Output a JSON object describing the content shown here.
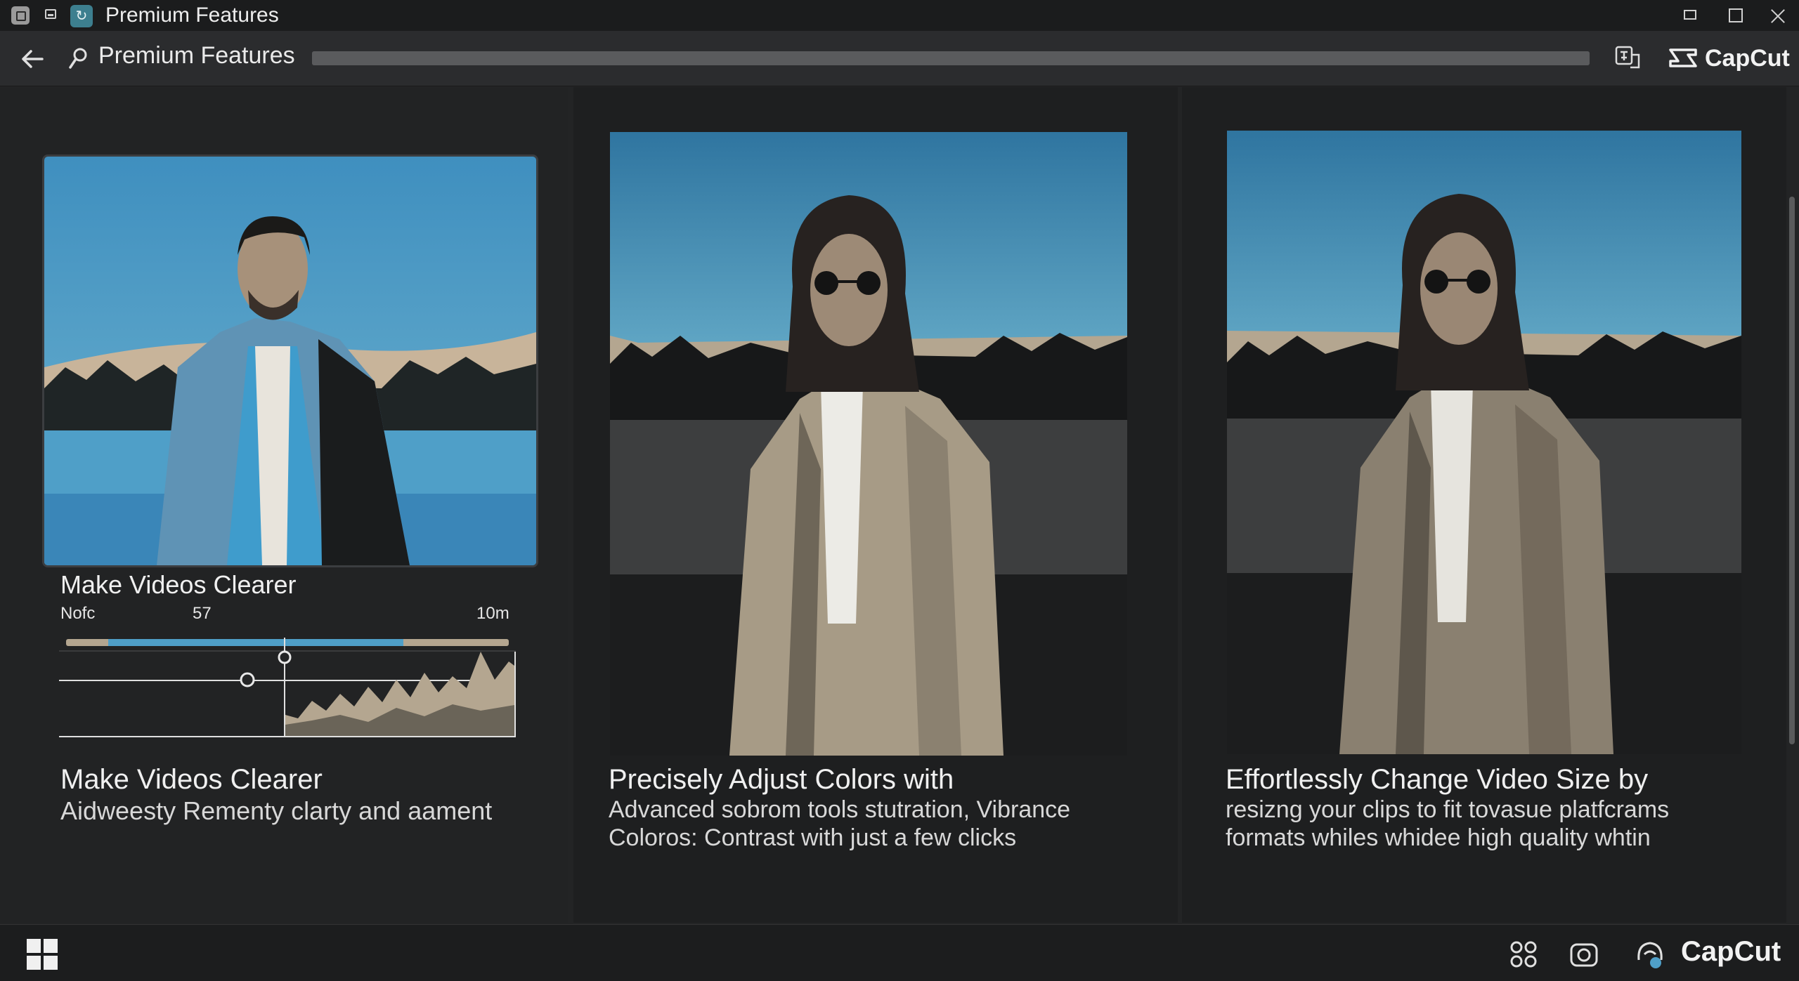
{
  "window": {
    "title": "Premium Features"
  },
  "toolbar": {
    "title": "Premium Features",
    "brand": "CapCut",
    "progress": 1.0
  },
  "cards": [
    {
      "subtitle": "Make Videos Clearer",
      "timeline_labels": [
        "Nofc",
        "57",
        "10m"
      ],
      "caption": "Make Videos Clearer",
      "description": [
        "Aidweesty Rementy clarty and aament"
      ]
    },
    {
      "caption": "Precisely Adjust Colors with",
      "description": [
        "Advanced sobrom tools stutration, Vibrance",
        "Coloros: Contrast with just a  few clicks"
      ]
    },
    {
      "caption": "Effortlessly Change Video Size by",
      "description": [
        "resizng your clips to fit tovasue platfcrams",
        "formats whiles whidee high quality whtin"
      ]
    }
  ],
  "taskbar": {
    "brand": "CapCut"
  },
  "colors": {
    "sky_blue": "#4fa0c8",
    "jacket_denim": "#5a8fb0",
    "tan": "#b4a690",
    "background": "#232425"
  },
  "icons": [
    "app-icon",
    "back-arrow-icon",
    "search-icon",
    "translate-icon",
    "capcut-logo-icon",
    "windows-start-icon",
    "widgets-icon",
    "camera-icon",
    "capcut-taskbar-icon"
  ]
}
